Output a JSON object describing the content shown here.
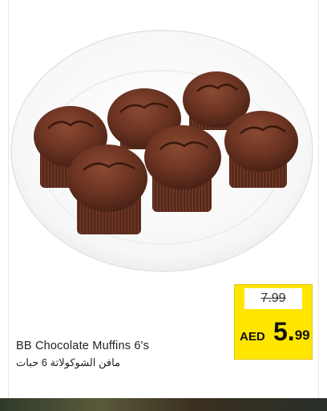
{
  "product": {
    "name_en": "BB Chocolate Muffins 6's",
    "name_ar": "مافن الشوكولاتة 6 حبات",
    "image_icon": "chocolate-muffins-photo"
  },
  "price": {
    "old": "7.99",
    "currency": "AED",
    "new_whole": "5.",
    "new_fraction": "99"
  },
  "colors": {
    "price_tag": "#ffe600",
    "plate": "#ffffff",
    "muffin": "#6b3424"
  }
}
